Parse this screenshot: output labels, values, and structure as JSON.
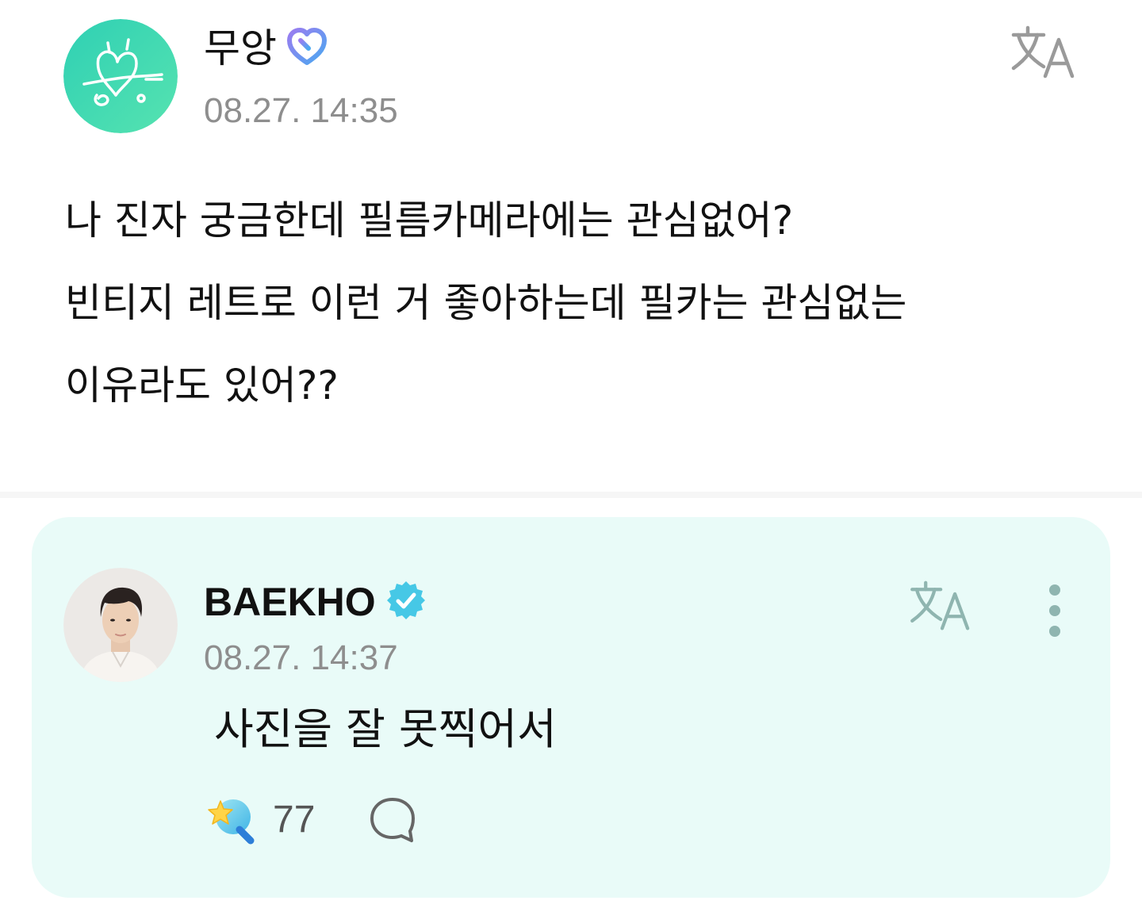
{
  "post": {
    "author_name": "무앙",
    "timestamp": "08.27. 14:35",
    "body": "나 진자 궁금한데 필름카메라에는 관심없어?\n빈티지 레트로 이런 거 좋아하는데 필카는 관심없는\n이유라도 있어??",
    "badge_icon": "membership-heart-icon",
    "avatar_color": "#3fd6b6"
  },
  "reply": {
    "author_name": "BAEKHO",
    "timestamp": "08.27. 14:37",
    "body": "사진을 잘 못찍어서",
    "badge_icon": "verified-check-icon",
    "like_count": "77",
    "card_color": "#e9fbf8",
    "accent_color": "#46c8e6"
  }
}
